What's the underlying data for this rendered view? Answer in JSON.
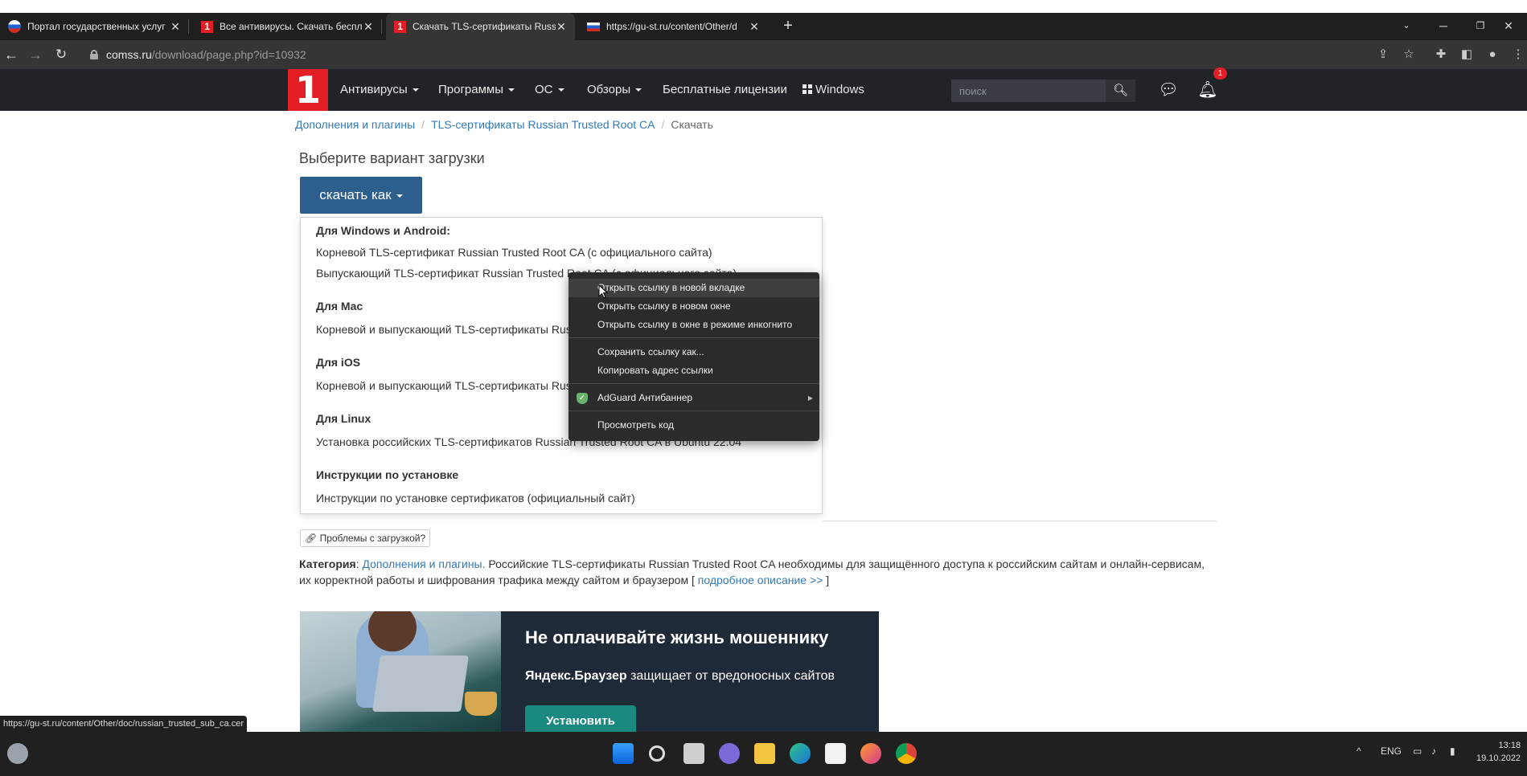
{
  "browser": {
    "tabs": [
      {
        "title": "Портал государственных услуг",
        "favicon": "gosuslugi-icon"
      },
      {
        "title": "Все антивирусы. Скачать беспл",
        "favicon": "comss-icon"
      },
      {
        "title": "Скачать TLS-сертификаты Russia",
        "favicon": "comss-icon"
      },
      {
        "title": "https://gu-st.ru/content/Other/d",
        "favicon": "ru-flag-icon"
      }
    ],
    "new_tab": "+",
    "url_host": "comss.ru",
    "url_path": "/download/page.php?id=10932"
  },
  "site": {
    "logo": "1",
    "menu": [
      {
        "label": "Антивирусы",
        "dropdown": true
      },
      {
        "label": "Программы",
        "dropdown": true
      },
      {
        "label": "ОС",
        "dropdown": true
      },
      {
        "label": "Обзоры",
        "dropdown": true
      },
      {
        "label": "Бесплатные лицензии",
        "dropdown": false
      },
      {
        "label": "Windows",
        "dropdown": false
      }
    ],
    "search_placeholder": "поиск",
    "notification_count": "1"
  },
  "breadcrumb": {
    "items": [
      "Дополнения и плагины",
      "TLS-сертификаты Russian Trusted Root CA"
    ],
    "current": "Скачать",
    "separator": "/"
  },
  "page": {
    "heading": "Выберите вариант загрузки",
    "download_button": "скачать как",
    "dropdown": {
      "windows_head": "Для Windows и Android:",
      "windows_item1": "Корневой TLS-сертификат Russian Trusted Root CA (с официального сайта)",
      "windows_item2": "Выпускающий TLS-сертификат Russian Trusted Root CA (с официального сайта)",
      "mac_head": "Для Mac",
      "mac_item": "Корневой и выпускающий TLS-сертификаты Russian Trusted Root CA",
      "ios_head": "Для iOS",
      "ios_item": "Корневой и выпускающий TLS-сертификаты Russian Trusted Root CA",
      "linux_head": "Для Linux",
      "linux_item": "Установка российских TLS-сертификатов Russian Trusted Root CA в Ubuntu 22.04",
      "instr_head": "Инструкции по установке",
      "instr_item": "Инструкции по установке сертификатов (официальный сайт)"
    },
    "problems_button": "Проблемы с загрузкой?",
    "category_label": "Категория",
    "category_link": "Дополнения и плагины.",
    "category_text": "Российские TLS-сертификаты Russian Trusted Root CA необходимы для защищённого доступа к российским сайтам и онлайн-сервисам, их корректной работы и шифрования трафика между сайтом и браузером [",
    "more_link": "подробное описание >>",
    "more_close": "]"
  },
  "ad": {
    "title": "Не оплачивайте жизнь мошеннику",
    "sub_bold": "Яндекс.Браузер",
    "sub_rest": "защищает от вредоносных сайтов",
    "button": "Установить"
  },
  "status_url": "https://gu-st.ru/content/Other/doc/russian_trusted_sub_ca.cer",
  "context_menu": {
    "items": [
      "Открыть ссылку в новой вкладке",
      "Открыть ссылку в новом окне",
      "Открыть ссылку в окне в режиме инкогнито",
      "Сохранить ссылку как...",
      "Копировать адрес ссылки",
      "AdGuard Антибаннер",
      "Просмотреть код"
    ]
  },
  "taskbar": {
    "lang": "ENG",
    "time": "13:18",
    "date": "19.10.2022"
  }
}
